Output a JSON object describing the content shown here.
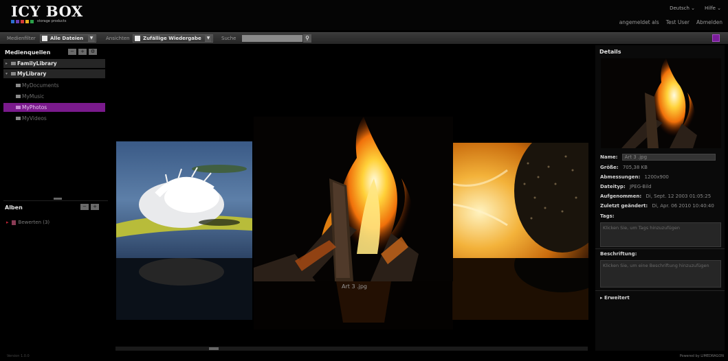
{
  "app": {
    "logo_text": "ICY BOX",
    "logo_tagline": "storage products",
    "logo_colors": [
      "#2b6fd1",
      "#6a3fb3",
      "#d33a3a",
      "#e6b020",
      "#2ba14a"
    ]
  },
  "header": {
    "top_menu": [
      {
        "label": "Deutsch ⌄"
      },
      {
        "label": "Hilfe ⌄"
      }
    ],
    "links": [
      {
        "label": "angemeldet als"
      },
      {
        "label": "Test User"
      },
      {
        "label": "Abmelden"
      }
    ]
  },
  "toolbar": {
    "filter_label": "Medienfilter",
    "filter_value": "Alle Dateien",
    "view_label": "Ansichten",
    "view_value": "Zufällige Wiedergabe",
    "search_label": "Suche",
    "search_value": "",
    "accent_color": "#7a1c9a"
  },
  "sources": {
    "title": "Medienquellen",
    "buttons": [
      "−",
      "+",
      "⚙"
    ],
    "items": [
      {
        "label": "FamilyLibrary",
        "type": "lib"
      },
      {
        "label": "MyLibrary",
        "type": "lib"
      },
      {
        "label": "MyDocuments",
        "type": "sub"
      },
      {
        "label": "MyMusic",
        "type": "sub"
      },
      {
        "label": "MyPhotos",
        "type": "sel"
      },
      {
        "label": "MyVideos",
        "type": "sub"
      }
    ]
  },
  "albums": {
    "title": "Alben",
    "buttons": [
      "−",
      "+"
    ],
    "items": [
      {
        "label": "Bewerten (3)"
      }
    ]
  },
  "viewer": {
    "caption": "Art 3 .jpg",
    "images": [
      {
        "name": "feather-image"
      },
      {
        "name": "fire-image"
      },
      {
        "name": "sunflower-image"
      }
    ]
  },
  "details": {
    "title": "Details",
    "name_label": "Name:",
    "name_value": "Art 3 .jpg",
    "rows": [
      {
        "label": "Größe:",
        "value": "705,38 KB"
      },
      {
        "label": "Abmessungen:",
        "value": "1200x900"
      },
      {
        "label": "Dateityp:",
        "value": "JPEG-Bild"
      },
      {
        "label": "Aufgenommen:",
        "value": "Di, Sept. 12 2003 01:05:25"
      },
      {
        "label": "Zuletzt geändert:",
        "value": "Di, Apr. 06 2010 10:40:40"
      }
    ],
    "tags_label": "Tags:",
    "tags_placeholder": "Klicken Sie, um Tags hinzuzufügen",
    "caption_label": "Beschriftung:",
    "caption_placeholder": "Klicken Sie, um eine Beschriftung hinzuzufügen",
    "advanced_label": "Erweitert"
  },
  "footer": {
    "left": "Version 1.0.0",
    "right": "Powered by LIMEDRAGON"
  }
}
